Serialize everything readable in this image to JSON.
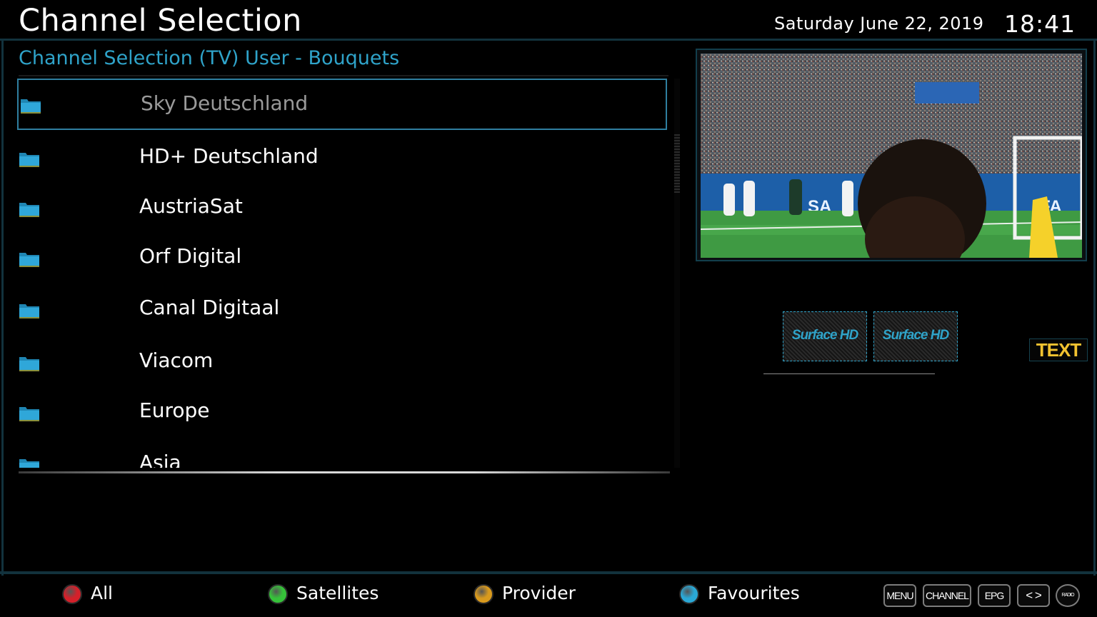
{
  "header": {
    "title": "Channel Selection",
    "date": "Saturday June 22, 2019",
    "time": "18:41"
  },
  "list": {
    "subtitle": "Channel Selection (TV) User - Bouquets",
    "selected_index": 0,
    "items": [
      {
        "label": "Sky Deutschland",
        "icon": "folder-icon"
      },
      {
        "label": "HD+ Deutschland",
        "icon": "folder-icon"
      },
      {
        "label": "AustriaSat",
        "icon": "folder-icon"
      },
      {
        "label": "Orf Digital",
        "icon": "folder-icon"
      },
      {
        "label": "Canal Digitaal",
        "icon": "folder-icon"
      },
      {
        "label": "Viacom",
        "icon": "folder-icon"
      },
      {
        "label": "Europe",
        "icon": "folder-icon"
      },
      {
        "label": "Asia",
        "icon": "folder-icon"
      }
    ]
  },
  "preview": {
    "badges": [
      "Surface HD",
      "Surface HD"
    ],
    "text_button": "TEXT"
  },
  "footer": {
    "color_buttons": [
      {
        "label": "All",
        "color": "#d4202a"
      },
      {
        "label": "Satellites",
        "color": "#36c23a"
      },
      {
        "label": "Provider",
        "color": "#d99a1d"
      },
      {
        "label": "Favourites",
        "color": "#2aa8d6"
      }
    ],
    "keys": {
      "menu": "MENU",
      "channel": "CHANNEL",
      "epg": "EPG",
      "arrows": "< >",
      "radio": "RADIO"
    }
  },
  "colors": {
    "accent": "#2fa3c9",
    "text_key": "#f2c230",
    "frame": "#12323d"
  }
}
